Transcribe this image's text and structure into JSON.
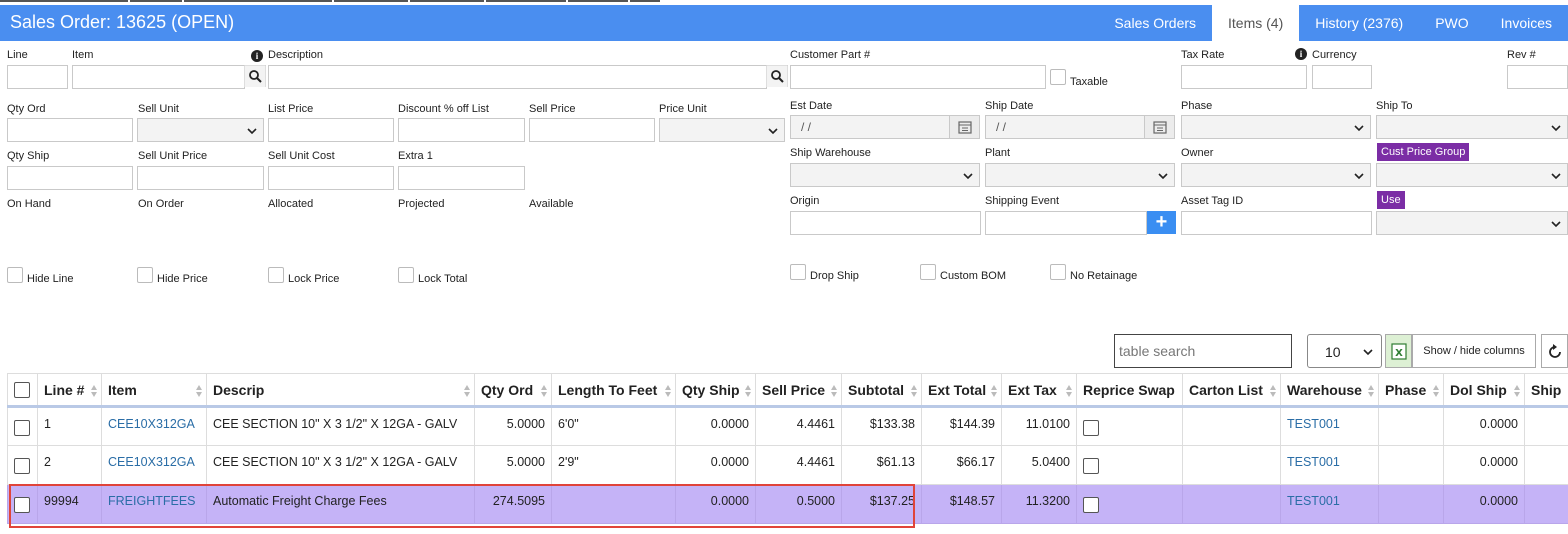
{
  "header": {
    "title": "Sales Order: 13625 (OPEN)",
    "tabs": [
      {
        "label": "Sales Orders",
        "active": false
      },
      {
        "label": "Items (4)",
        "active": true
      },
      {
        "label": "History (2376)",
        "active": false
      },
      {
        "label": "PWO",
        "active": false
      },
      {
        "label": "Invoices",
        "active": false
      }
    ]
  },
  "form": {
    "line": "Line",
    "item": "Item",
    "description": "Description",
    "customer_part": "Customer Part #",
    "taxable": "Taxable",
    "tax_rate": "Tax Rate",
    "currency": "Currency",
    "rev": "Rev #",
    "qty_ord": "Qty Ord",
    "sell_unit": "Sell Unit",
    "list_price": "List Price",
    "discount": "Discount % off List",
    "sell_price": "Sell Price",
    "price_unit": "Price Unit",
    "est_date": "Est Date",
    "ship_date": "Ship Date",
    "phase": "Phase",
    "ship_to": "Ship To",
    "date_placeholder": "/ /",
    "qty_ship": "Qty Ship",
    "sell_unit_price": "Sell Unit Price",
    "sell_unit_cost": "Sell Unit Cost",
    "extra1": "Extra 1",
    "ship_warehouse": "Ship Warehouse",
    "plant": "Plant",
    "owner": "Owner",
    "cust_price_group": "Cust Price Group",
    "on_hand": "On Hand",
    "on_order": "On Order",
    "allocated": "Allocated",
    "projected": "Projected",
    "available": "Available",
    "origin": "Origin",
    "shipping_event": "Shipping Event",
    "asset_tag": "Asset Tag ID",
    "use": "Use",
    "hide_line": "Hide Line",
    "hide_price": "Hide Price",
    "lock_price": "Lock Price",
    "lock_total": "Lock Total",
    "drop_ship": "Drop Ship",
    "custom_bom": "Custom BOM",
    "no_retainage": "No Retainage"
  },
  "toolbar": {
    "search_placeholder": "table search",
    "page_size": "10",
    "show_hide": "Show / hide columns"
  },
  "table": {
    "headers": [
      "Line #",
      "Item",
      "Descrip",
      "Qty Ord",
      "Length To Feet",
      "Qty Ship",
      "Sell Price",
      "Subtotal",
      "Ext Total",
      "Ext Tax",
      "Reprice Swap",
      "Carton List",
      "Warehouse",
      "Phase",
      "Dol Ship",
      "Ship"
    ],
    "rows": [
      {
        "line": "1",
        "item": "CEE10X312GA",
        "descrip": "CEE SECTION 10\" X 3 1/2\" X 12GA - GALV",
        "qty_ord": "5.0000",
        "length": "6'0\"",
        "qty_ship": "0.0000",
        "sell_price": "4.4461",
        "subtotal": "$133.38",
        "ext_total": "$144.39",
        "ext_tax": "11.0100",
        "carton": "",
        "warehouse": "TEST001",
        "phase": "",
        "dol_ship": "0.0000",
        "ship": ""
      },
      {
        "line": "2",
        "item": "CEE10X312GA",
        "descrip": "CEE SECTION 10\" X 3 1/2\" X 12GA - GALV",
        "qty_ord": "5.0000",
        "length": "2'9\"",
        "qty_ship": "0.0000",
        "sell_price": "4.4461",
        "subtotal": "$61.13",
        "ext_total": "$66.17",
        "ext_tax": "5.0400",
        "carton": "",
        "warehouse": "TEST001",
        "phase": "",
        "dol_ship": "0.0000",
        "ship": ""
      },
      {
        "line": "99994",
        "item": "FREIGHTFEES",
        "descrip": "Automatic Freight Charge Fees",
        "qty_ord": "274.5095",
        "length": "",
        "qty_ship": "0.0000",
        "sell_price": "0.5000",
        "subtotal": "$137.25",
        "ext_total": "$148.57",
        "ext_tax": "11.3200",
        "carton": "",
        "warehouse": "TEST001",
        "phase": "",
        "dol_ship": "0.0000",
        "ship": ""
      }
    ]
  },
  "colors": {
    "header_bg": "#4a8ef0",
    "highlight_row": "#c5b3f7",
    "badge_purple": "#7b2da5",
    "annotation_red": "#e0443a"
  }
}
